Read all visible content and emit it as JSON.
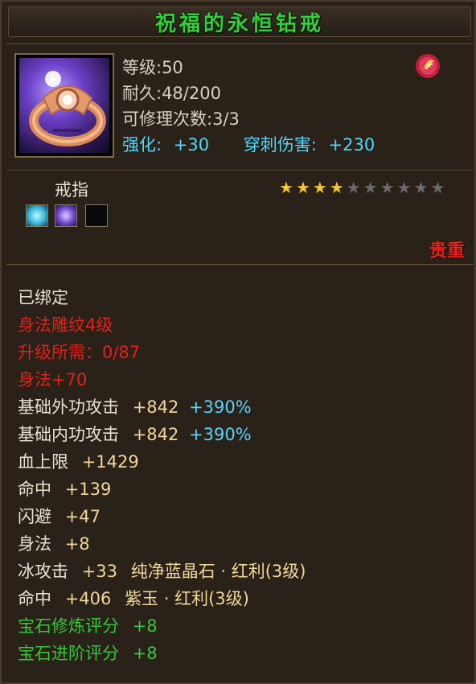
{
  "item": {
    "name": "祝福的永恒钻戒",
    "level": "等级:50",
    "durability": "耐久:48/200",
    "repairs": "可修理次数:3/3",
    "enhance_label": "强化:",
    "enhance_value": "+30",
    "pierce_label": "穿刺伤害:",
    "pierce_value": "+230",
    "type": "戒指",
    "stars_filled": 4,
    "stars_total": 10,
    "rarity": "贵重"
  },
  "attributes": {
    "bound": "已绑定",
    "skill_level": "身法雕纹4级",
    "upgrade_req": "升级所需：0/87",
    "skill_bonus": "身法+70",
    "outer_atk_label": "基础外功攻击",
    "outer_atk_val": "+842",
    "outer_atk_pct": "+390%",
    "inner_atk_label": "基础内功攻击",
    "inner_atk_val": "+842",
    "inner_atk_pct": "+390%",
    "hp_label": "血上限",
    "hp_val": "+1429",
    "hit_label": "命中",
    "hit_val": "+139",
    "dodge_label": "闪避",
    "dodge_val": "+47",
    "agility_label": "身法",
    "agility_val": "+8",
    "ice_label": "冰攻击",
    "ice_val": "+33",
    "ice_gem": "纯净蓝晶石 · 红利(3级)",
    "hit2_label": "命中",
    "hit2_val": "+406",
    "hit2_gem": "紫玉 · 红利(3级)",
    "gem_refine": "宝石修炼评分",
    "gem_refine_val": "+8",
    "gem_advance": "宝石进阶评分",
    "gem_advance_val": "+8"
  },
  "colors": {
    "title": "#2fd23a",
    "rare": "#e8221c",
    "cyan": "#4ed8ff",
    "star_filled": "#f4c530",
    "star_empty": "#6a6a6a"
  }
}
